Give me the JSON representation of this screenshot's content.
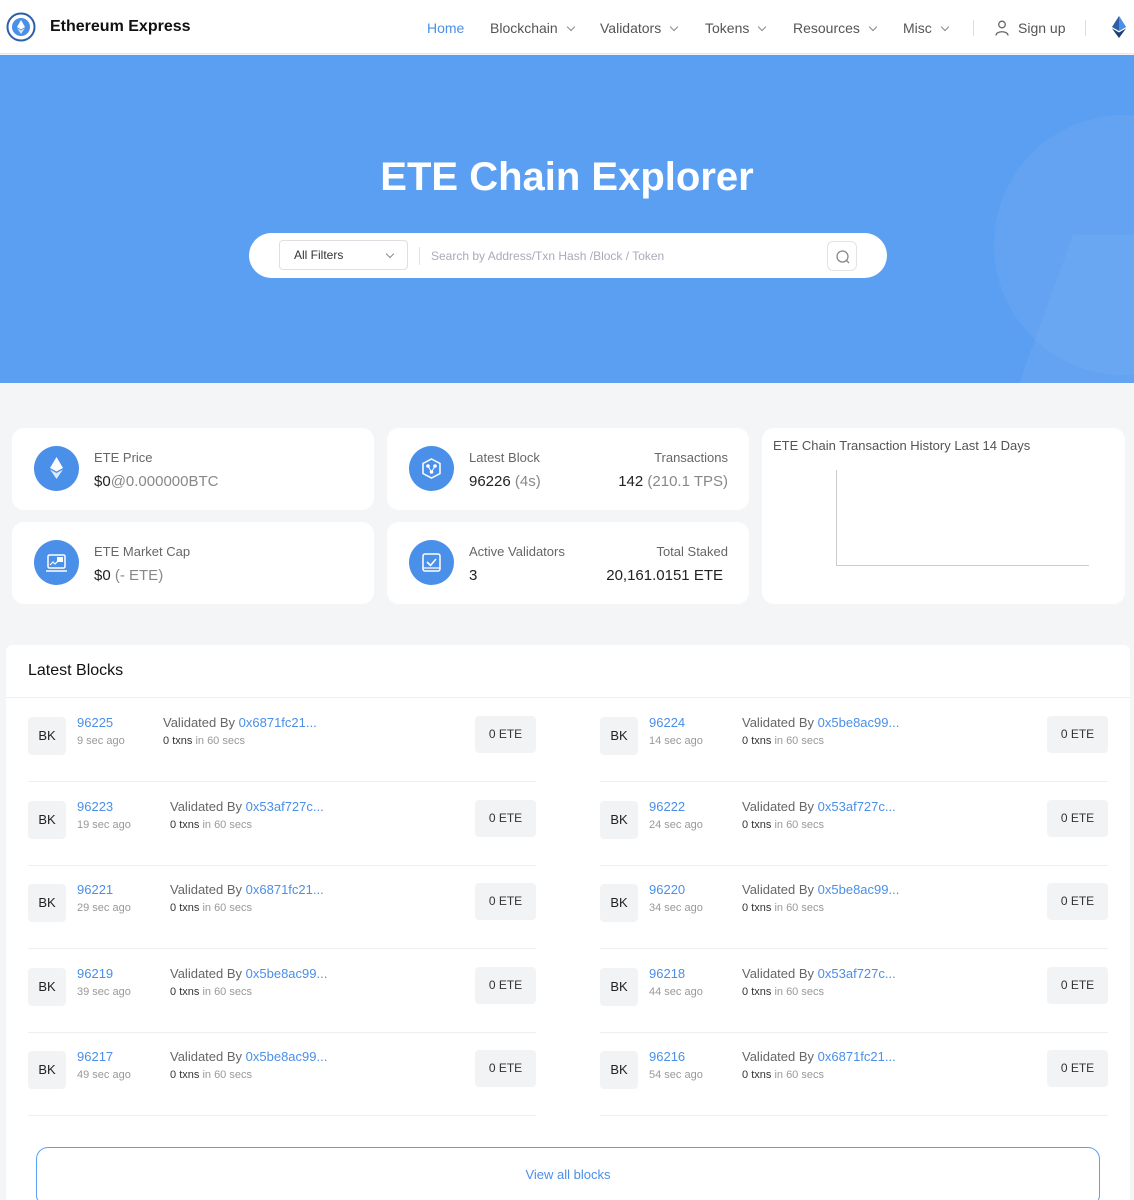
{
  "nav": {
    "brand": "Ethereum Express",
    "items": [
      {
        "label": "Home",
        "dropdown": false,
        "active": true
      },
      {
        "label": "Blockchain",
        "dropdown": true,
        "active": false
      },
      {
        "label": "Validators",
        "dropdown": true,
        "active": false
      },
      {
        "label": "Tokens",
        "dropdown": true,
        "active": false
      },
      {
        "label": "Resources",
        "dropdown": true,
        "active": false
      },
      {
        "label": "Misc",
        "dropdown": true,
        "active": false
      }
    ],
    "signup": "Sign up",
    "accent": "#4a8fe8"
  },
  "hero": {
    "title": "ETE Chain Explorer",
    "filter": "All Filters",
    "search_placeholder": "Search by Address/Txn Hash /Block / Token",
    "bg": "#5b9ff2"
  },
  "stats": {
    "price_label": "ETE Price",
    "price_value": "$0",
    "price_btc": "@0.000000BTC",
    "latest_block_label": "Latest Block",
    "latest_block_value": "96226",
    "latest_block_age": "(4s)",
    "transactions_label": "Transactions",
    "transactions_value": "142",
    "transactions_tps": "(210.1 TPS)",
    "market_cap_label": "ETE Market Cap",
    "market_cap_value": "$0",
    "market_cap_ete": "(- ETE)",
    "active_validators_label": "Active Validators",
    "active_validators_value": "3",
    "total_staked_label": "Total Staked",
    "total_staked_value": "20,161.0151 ETE"
  },
  "chart": {
    "title": "ETE Chain Transaction History Last 14 Days"
  },
  "chart_data": {
    "type": "line",
    "title": "ETE Chain Transaction History Last 14 Days",
    "x": [],
    "series": []
  },
  "blocks": {
    "title": "Latest Blocks",
    "bk_label": "BK",
    "validated_by": "Validated By",
    "txns_word": "txns",
    "in_word": "in",
    "items": [
      {
        "number": "96225",
        "age": "9 sec ago",
        "validator": "0x6871fc21...",
        "txns": "0",
        "duration": "60 secs",
        "reward": "0 ETE"
      },
      {
        "number": "96224",
        "age": "14 sec ago",
        "validator": "0x5be8ac99...",
        "txns": "0",
        "duration": "60 secs",
        "reward": "0 ETE"
      },
      {
        "number": "96223",
        "age": "19 sec ago",
        "validator": "0x53af727c...",
        "txns": "0",
        "duration": "60 secs",
        "reward": "0 ETE"
      },
      {
        "number": "96222",
        "age": "24 sec ago",
        "validator": "0x53af727c...",
        "txns": "0",
        "duration": "60 secs",
        "reward": "0 ETE"
      },
      {
        "number": "96221",
        "age": "29 sec ago",
        "validator": "0x6871fc21...",
        "txns": "0",
        "duration": "60 secs",
        "reward": "0 ETE"
      },
      {
        "number": "96220",
        "age": "34 sec ago",
        "validator": "0x5be8ac99...",
        "txns": "0",
        "duration": "60 secs",
        "reward": "0 ETE"
      },
      {
        "number": "96219",
        "age": "39 sec ago",
        "validator": "0x5be8ac99...",
        "txns": "0",
        "duration": "60 secs",
        "reward": "0 ETE"
      },
      {
        "number": "96218",
        "age": "44 sec ago",
        "validator": "0x53af727c...",
        "txns": "0",
        "duration": "60 secs",
        "reward": "0 ETE"
      },
      {
        "number": "96217",
        "age": "49 sec ago",
        "validator": "0x5be8ac99...",
        "txns": "0",
        "duration": "60 secs",
        "reward": "0 ETE"
      },
      {
        "number": "96216",
        "age": "54 sec ago",
        "validator": "0x6871fc21...",
        "txns": "0",
        "duration": "60 secs",
        "reward": "0 ETE"
      }
    ],
    "view_all": "View all blocks"
  }
}
